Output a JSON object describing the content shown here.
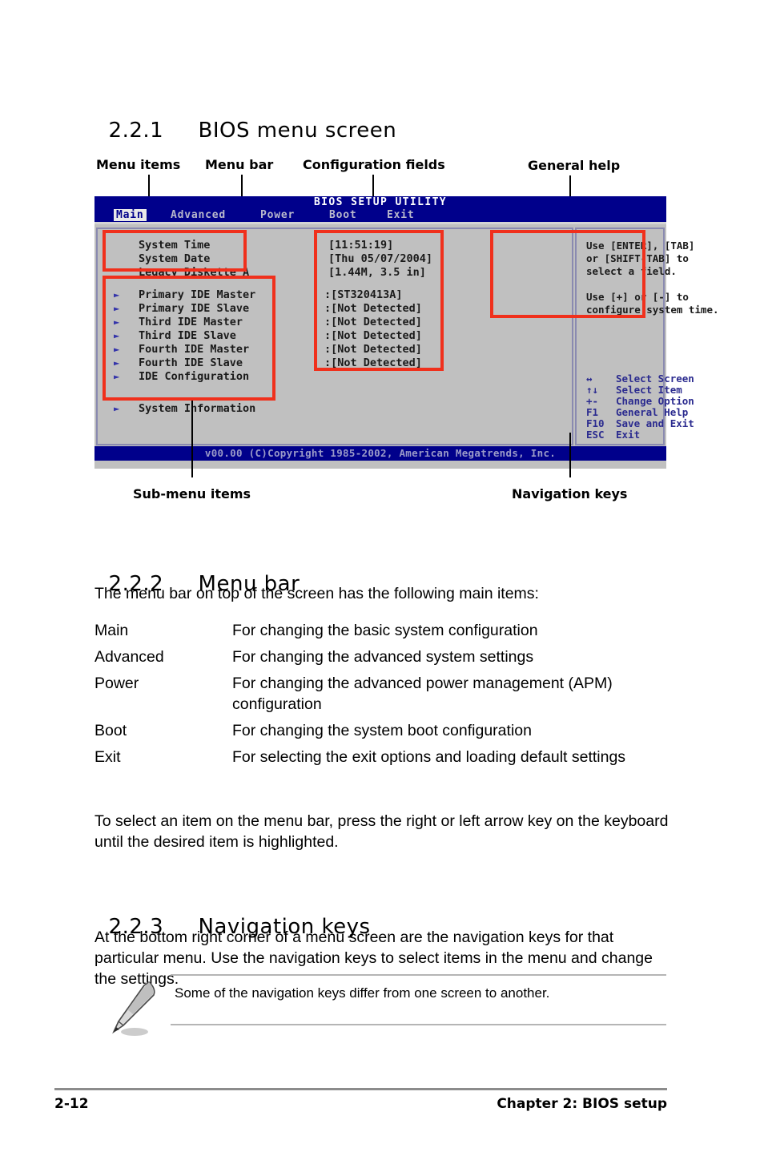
{
  "page": {
    "number": "2-12",
    "chapter": "Chapter 2: BIOS setup"
  },
  "sections": {
    "s221": {
      "num": "2.2.1",
      "title": "BIOS menu screen"
    },
    "s222": {
      "num": "2.2.2",
      "title": "Menu bar"
    },
    "s223": {
      "num": "2.2.3",
      "title": "Navigation keys"
    }
  },
  "figure": {
    "callouts": {
      "menu_items": "Menu items",
      "menu_bar": "Menu bar",
      "configuration_fields": "Configuration fields",
      "general_help": "General help",
      "sub_menu_items": "Sub-menu items",
      "navigation_keys": "Navigation keys"
    },
    "bios": {
      "title": "BIOS SETUP UTILITY",
      "menu_tabs": [
        {
          "label": "Main",
          "active": true
        },
        {
          "label": "Advanced",
          "active": false
        },
        {
          "label": "Power",
          "active": false
        },
        {
          "label": "Boot",
          "active": false
        },
        {
          "label": "Exit",
          "active": false
        }
      ],
      "settings": [
        {
          "name": "System Time",
          "value": "[11:51:19]"
        },
        {
          "name": "System Date",
          "value": "[Thu 05/07/2004]"
        },
        {
          "name": "Legacy Diskette A",
          "value": "[1.44M, 3.5 in]"
        }
      ],
      "submenus": [
        {
          "name": "Primary IDE Master",
          "value": ":[ST320413A]"
        },
        {
          "name": "Primary IDE Slave",
          "value": ":[Not Detected]"
        },
        {
          "name": "Third IDE Master",
          "value": ":[Not Detected]"
        },
        {
          "name": "Third IDE Slave",
          "value": ":[Not Detected]"
        },
        {
          "name": "Fourth IDE Master",
          "value": ":[Not Detected]"
        },
        {
          "name": "Fourth IDE Slave",
          "value": ":[Not Detected]"
        },
        {
          "name": "IDE Configuration",
          "value": ""
        }
      ],
      "system_information": "System Information",
      "help_lines": [
        "Use [ENTER], [TAB]",
        "or [SHIFT-TAB] to",
        "select a field.",
        "",
        "Use [+] or [-] to",
        "configure system time."
      ],
      "nav_keys": [
        {
          "key": "↔",
          "desc": "Select Screen"
        },
        {
          "key": "↑↓",
          "desc": "Select Item"
        },
        {
          "key": "+-",
          "desc": "Change Option"
        },
        {
          "key": "F1",
          "desc": "General Help"
        },
        {
          "key": "F10",
          "desc": "Save and Exit"
        },
        {
          "key": "ESC",
          "desc": "Exit"
        }
      ],
      "footer": "v00.00 (C)Copyright 1985-2002, American Megatrends, Inc."
    },
    "colors": {
      "highlight_box": "#f0301c",
      "bios_blue": "#00008b",
      "bios_gray": "#c0c0c0"
    }
  },
  "menu_bar_section": {
    "intro": "The menu bar on top of the screen has the following main items:",
    "items": [
      {
        "term": "Main",
        "desc": "For changing the basic system configuration"
      },
      {
        "term": "Advanced",
        "desc": "For changing the advanced system settings"
      },
      {
        "term": "Power",
        "desc": "For changing the advanced power management (APM) configuration"
      },
      {
        "term": "Boot",
        "desc": "For changing the system boot configuration"
      },
      {
        "term": "Exit",
        "desc": "For selecting the exit options and loading default settings"
      }
    ],
    "outro": "To select an item on the menu bar, press the right or left arrow key on the keyboard until the desired item is highlighted."
  },
  "navigation_keys_section": {
    "body": "At the bottom right corner of a menu screen are the navigation keys for that particular menu. Use the navigation keys to select items in the menu and change the settings.",
    "note": "Some of the navigation keys differ from one screen to another."
  }
}
